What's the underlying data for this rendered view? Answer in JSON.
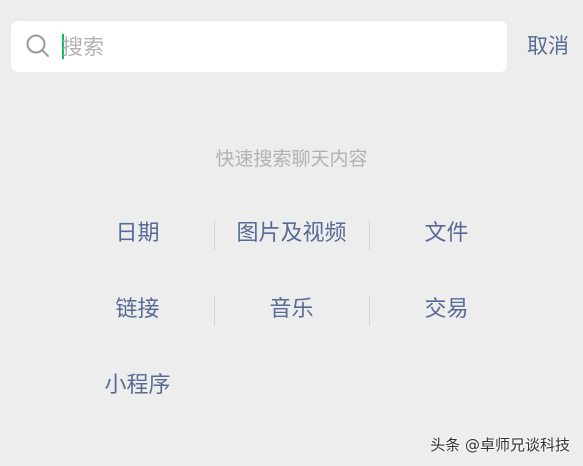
{
  "search": {
    "placeholder": "搜索",
    "value": "",
    "cancel_label": "取消"
  },
  "quick_search": {
    "title": "快速搜索聊天内容",
    "categories": [
      "日期",
      "图片及视频",
      "文件",
      "链接",
      "音乐",
      "交易",
      "小程序"
    ]
  },
  "watermark": {
    "text": "头条 @卓师兄谈科技"
  },
  "colors": {
    "background": "#ededed",
    "link": "#576b95",
    "hint": "#b2b2b2",
    "caret": "#07c160"
  }
}
